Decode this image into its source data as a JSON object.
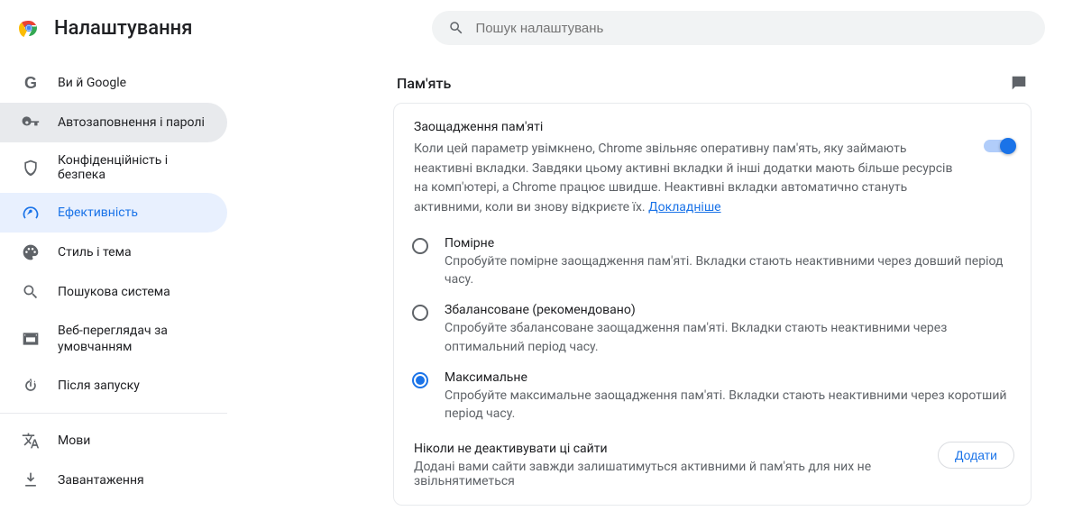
{
  "header": {
    "title": "Налаштування",
    "search_placeholder": "Пошук налаштувань"
  },
  "sidebar": {
    "items": [
      {
        "label": "Ви й Google"
      },
      {
        "label": "Автозаповнення і паролі"
      },
      {
        "label": "Конфіденційність і безпека"
      },
      {
        "label": "Ефективність"
      },
      {
        "label": "Стиль і тема"
      },
      {
        "label": "Пошукова система"
      },
      {
        "label": "Веб-переглядач за умовчанням"
      },
      {
        "label": "Після запуску"
      },
      {
        "label": "Мови"
      },
      {
        "label": "Завантаження"
      }
    ]
  },
  "main": {
    "section_title": "Пам'ять",
    "memory": {
      "title": "Заощадження пам'яті",
      "desc": "Коли цей параметр увімкнено, Chrome звільняє оперативну пам'ять, яку займають неактивні вкладки. Завдяки цьому активні вкладки й інші додатки мають більше ресурсів на комп'ютері, а Chrome працює швидше. Неактивні вкладки автоматично стануть активними, коли ви знову відкриєте їх. ",
      "learn_more": "Докладніше"
    },
    "options": [
      {
        "label": "Помірне",
        "desc": "Спробуйте помірне заощадження пам'яті. Вкладки стають неактивними через довший період часу."
      },
      {
        "label": "Збалансоване (рекомендовано)",
        "desc": "Спробуйте збалансоване заощадження пам'яті. Вкладки стають неактивними через оптимальний період часу."
      },
      {
        "label": "Максимальне",
        "desc": "Спробуйте максимальне заощадження пам'яті. Вкладки стають неактивними через коротший період часу."
      }
    ],
    "never": {
      "title": "Ніколи не деактивувати ці сайти",
      "desc": "Додані вами сайти завжди залишатимуться активними й пам'ять для них не звільнятиметься",
      "add_button": "Додати"
    }
  }
}
